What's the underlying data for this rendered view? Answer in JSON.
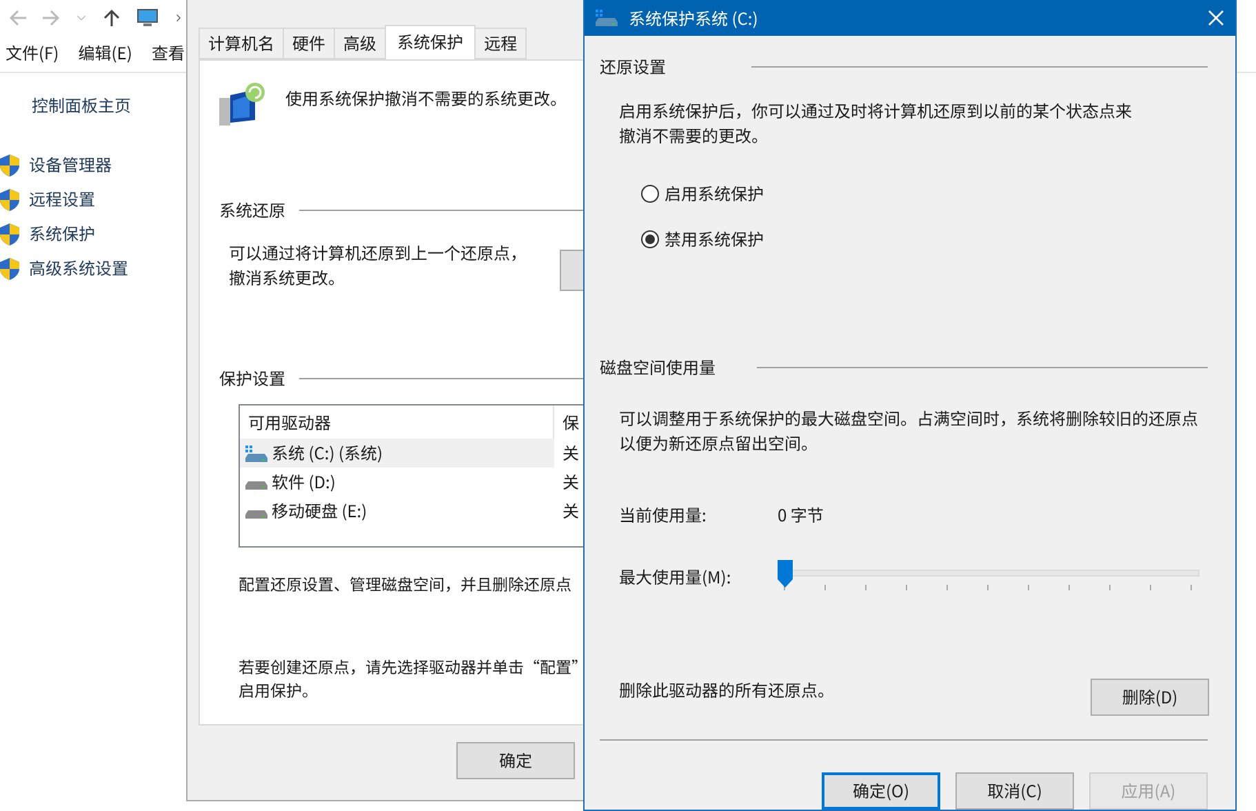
{
  "explorer": {
    "menu": [
      "文件(F)",
      "编辑(E)",
      "查看"
    ],
    "sidebar": {
      "home": "控制面板主页",
      "items": [
        "设备管理器",
        "远程设置",
        "系统保护",
        "高级系统设置"
      ]
    }
  },
  "system_properties": {
    "tabs": [
      {
        "label": "计算机名",
        "selected": false
      },
      {
        "label": "硬件",
        "selected": false
      },
      {
        "label": "高级",
        "selected": false
      },
      {
        "label": "系统保护",
        "selected": true
      },
      {
        "label": "远程",
        "selected": false
      }
    ],
    "intro": "使用系统保护撤消不需要的系统更改。",
    "restore_group": {
      "title": "系统还原",
      "text": "可以通过将计算机还原到上一个还原点，撤消系统更改。"
    },
    "protection_group": {
      "title": "保护设置",
      "columns": [
        "可用驱动器",
        "保"
      ],
      "drives": [
        {
          "name": "系统 (C:) (系统)",
          "column_2": "关",
          "kind": "system",
          "selected": true
        },
        {
          "name": "软件 (D:)",
          "column_2": "关",
          "kind": "disk",
          "selected": false
        },
        {
          "name": "移动硬盘 (E:)",
          "column_2": "关",
          "kind": "disk",
          "selected": false
        }
      ]
    },
    "configure_text": "配置还原设置、管理磁盘空间，并且删除还原点",
    "create_text_lines": [
      "若要创建还原点，请先选择驱动器并单击“配置”",
      "启用保护。"
    ],
    "buttons": [
      "确定"
    ]
  },
  "dialog": {
    "title": "系统保护系统 (C:)",
    "restore_settings": {
      "title": "还原设置",
      "text": "启用系统保护后，你可以通过及时将计算机还原到以前的某个状态点来撤消不需要的更改。",
      "options": [
        {
          "label": "启用系统保护",
          "selected": false
        },
        {
          "label": "禁用系统保护",
          "selected": true
        }
      ]
    },
    "disk_usage": {
      "title": "磁盘空间使用量",
      "text": "可以调整用于系统保护的最大磁盘空间。占满空间时，系统将删除较旧的还原点以便为新还原点留出空间。",
      "current_label": "当前使用量:",
      "current_value": "0 字节",
      "max_label": "最大使用量(M):",
      "max_slider": {
        "level": 0
      },
      "delete_text": "删除此驱动器的所有还原点。",
      "delete_button": "删除(D)"
    },
    "buttons": [
      {
        "label": "确定(O)",
        "default": true,
        "disabled": false
      },
      {
        "label": "取消(C)",
        "default": false,
        "disabled": false
      },
      {
        "label": "应用(A)",
        "default": false,
        "disabled": true
      }
    ]
  }
}
